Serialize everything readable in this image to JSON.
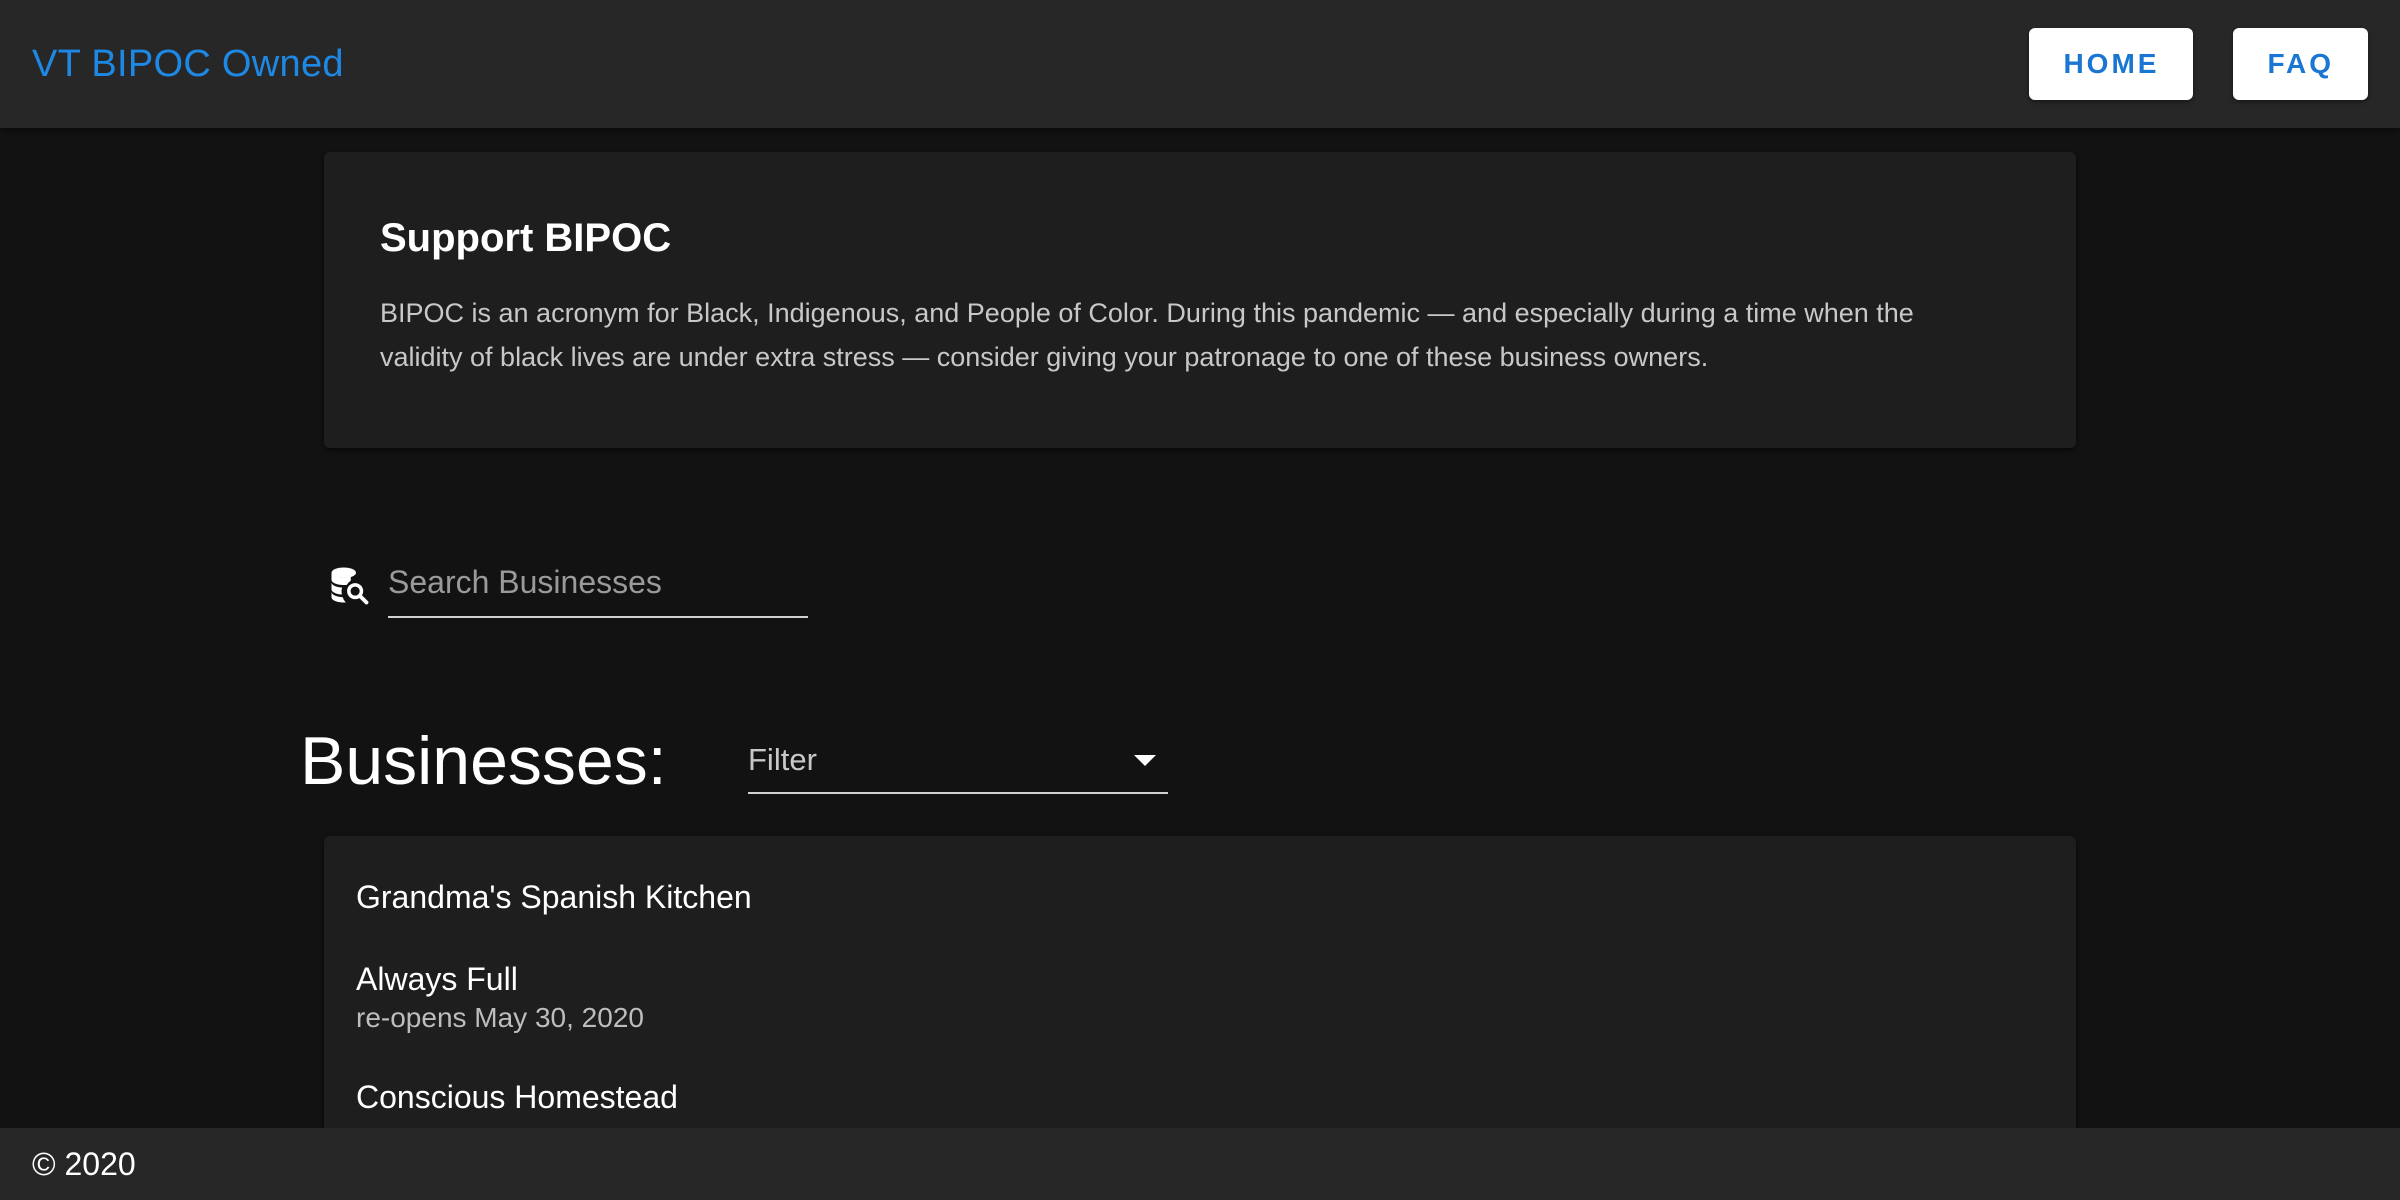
{
  "header": {
    "brand": "VT BIPOC Owned",
    "nav": {
      "home_label": "HOME",
      "faq_label": "FAQ"
    }
  },
  "intro": {
    "title": "Support BIPOC",
    "text_line1": "BIPOC is an acronym for Black, Indigenous, and People of Color. During this pandemic — and especially during a time when the",
    "text_line2": "validity of black lives are under extra stress — consider giving your patronage to one of these business owners."
  },
  "search": {
    "icon": "database-search-icon",
    "placeholder": "Search Businesses",
    "value": ""
  },
  "businesses": {
    "heading": "Businesses:",
    "filter": {
      "label": "Filter",
      "icon": "caret-down-icon"
    },
    "items": [
      {
        "name": "Grandma's Spanish Kitchen",
        "note": ""
      },
      {
        "name": "Always Full",
        "note": "re-opens May 30, 2020"
      },
      {
        "name": "Conscious Homestead",
        "note": ""
      }
    ]
  },
  "footer": {
    "text": "© 2020"
  },
  "colors": {
    "background": "#121212",
    "app_bar": "#272727",
    "card": "#1e1e1e",
    "accent": "#1976d2",
    "brand": "#1e88e5"
  }
}
